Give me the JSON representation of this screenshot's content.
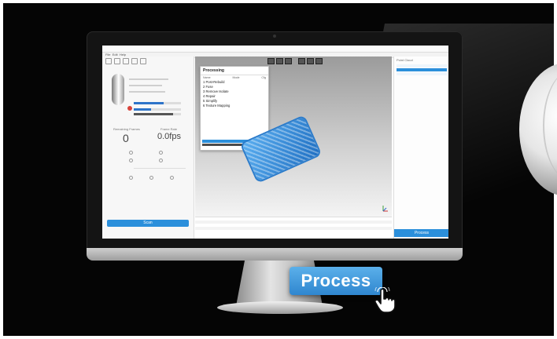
{
  "app": {
    "window_title": "",
    "menu": [
      "File",
      "Edit",
      "Help"
    ]
  },
  "left_panel": {
    "stat_left_label": "Remaining Frames",
    "stat_left_value": "0",
    "stat_right_label": "Frame Rate",
    "stat_right_value": "0.0fps",
    "scan_button": "Scan"
  },
  "processing_panel": {
    "title": "Processing",
    "columns": [
      "Name",
      "Mode",
      "Cfg"
    ],
    "steps": [
      "1  Post-Rebuild",
      "2  Fuse",
      "3  Remove Isolate",
      "4  Repair",
      "5  Simplify",
      "6  Texture Mapping"
    ]
  },
  "right_panel": {
    "header": "Point Cloud",
    "process_button": "Process"
  },
  "hero": {
    "process_button": "Process"
  },
  "colors": {
    "accent": "#2b8fdb",
    "model": "#3a94e0",
    "background": "#050505"
  },
  "icons": {
    "cursor": "hand-pointer-icon"
  }
}
